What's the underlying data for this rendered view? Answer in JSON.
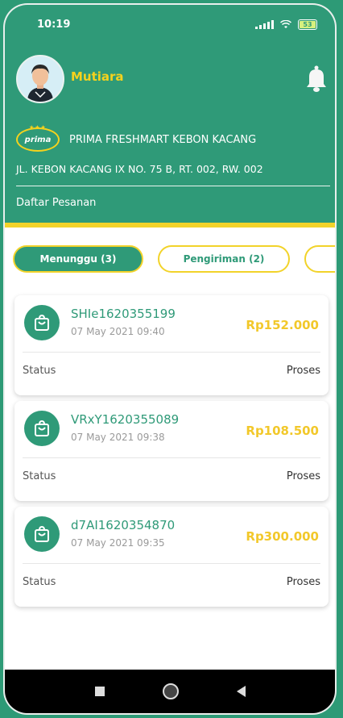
{
  "statusbar": {
    "time": "10:19",
    "battery": "53"
  },
  "header": {
    "username": "Mutiara",
    "store_logo_text": "prima",
    "store_name": "PRIMA FRESHMART KEBON KACANG",
    "address": "JL. KEBON KACANG IX NO. 75 B, RT. 002, RW. 002",
    "section_title": "Daftar Pesanan"
  },
  "tabs": [
    {
      "label": "Menunggu (3)"
    },
    {
      "label": "Pengiriman (2)"
    }
  ],
  "orders": [
    {
      "id": "SHIe1620355199",
      "date": "07 May 2021 09:40",
      "price": "Rp152.000",
      "status_label": "Status",
      "status_value": "Proses"
    },
    {
      "id": "VRxY1620355089",
      "date": "07 May 2021 09:38",
      "price": "Rp108.500",
      "status_label": "Status",
      "status_value": "Proses"
    },
    {
      "id": "d7AI1620354870",
      "date": "07 May 2021 09:35",
      "price": "Rp300.000",
      "status_label": "Status",
      "status_value": "Proses"
    }
  ],
  "colors": {
    "primary": "#2f9a78",
    "accent": "#f2d32a",
    "price": "#f2c82a"
  },
  "icons": {
    "notification": "bell-icon",
    "order": "shopping-bag-icon",
    "nav": [
      "square-icon",
      "circle-icon",
      "back-icon"
    ]
  }
}
